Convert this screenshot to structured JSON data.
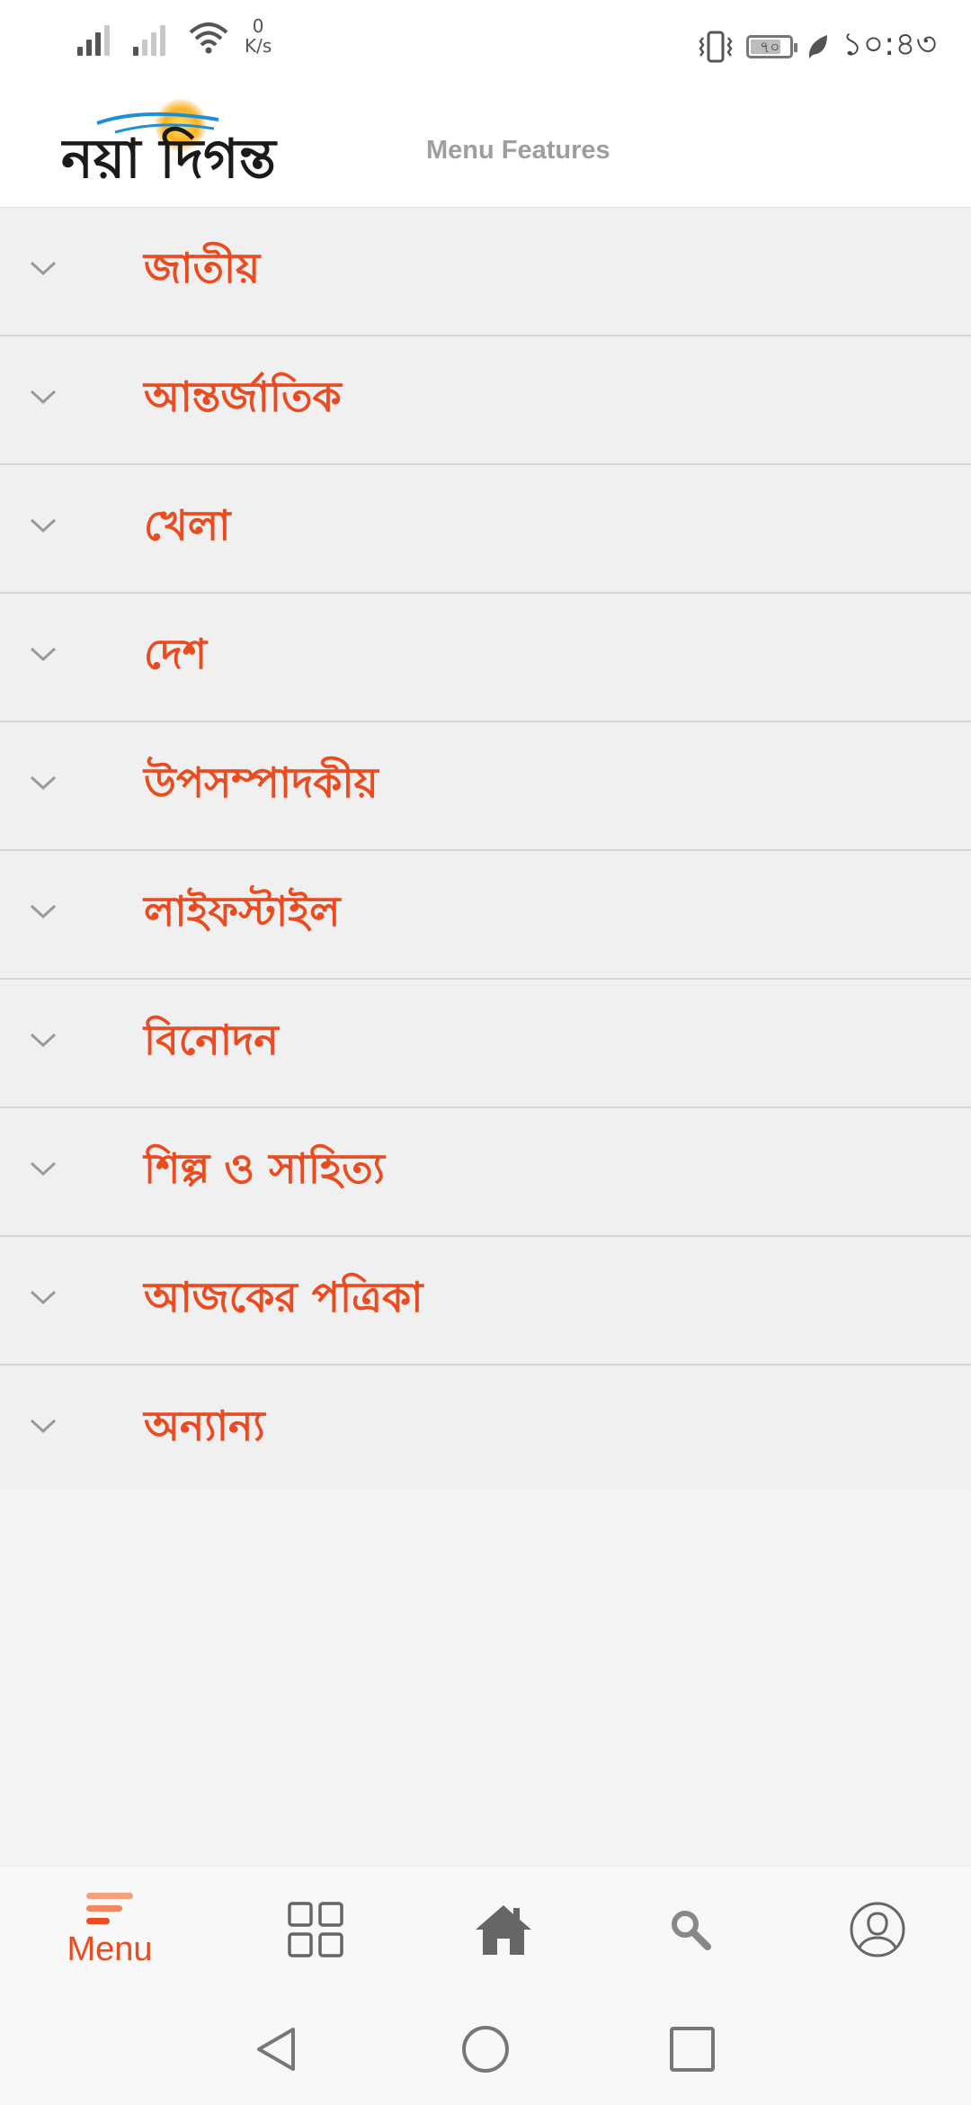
{
  "status_bar": {
    "speed_value": "0",
    "speed_unit": "K/s",
    "battery": "৭০",
    "time": "১০:৪৩"
  },
  "header": {
    "logo_text": "নয়া দিগন্ত",
    "subtitle": "Menu Features"
  },
  "menu": {
    "items": [
      {
        "label": "জাতীয়"
      },
      {
        "label": "আন্তর্জাতিক"
      },
      {
        "label": "খেলা"
      },
      {
        "label": "দেশ"
      },
      {
        "label": "উপসম্পাদকীয়"
      },
      {
        "label": "লাইফস্টাইল"
      },
      {
        "label": "বিনোদন"
      },
      {
        "label": "শিল্প ও সাহিত্য"
      },
      {
        "label": "আজকের পত্রিকা"
      },
      {
        "label": "অন্যান্য"
      }
    ]
  },
  "tabbar": {
    "menu_label": "Menu",
    "icons": [
      "menu-icon",
      "grid-icon",
      "home-icon",
      "search-icon",
      "profile-icon"
    ]
  },
  "colors": {
    "accent": "#ec4a1f",
    "row_bg": "#f0f0f0",
    "divider": "#d6d6d6",
    "muted": "#9e9e9e"
  }
}
